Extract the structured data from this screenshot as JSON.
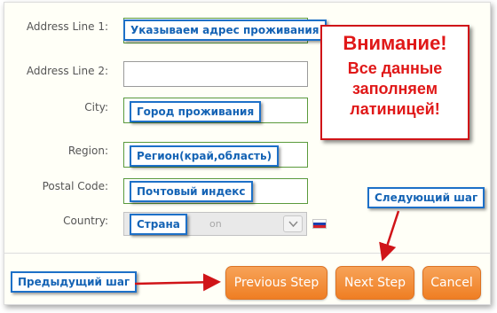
{
  "form": {
    "address1": {
      "label": "Address Line 1:",
      "hint": "Указываем адрес проживания"
    },
    "address2": {
      "label": "Address Line 2:"
    },
    "city": {
      "label": "City:",
      "hint": "Город проживания"
    },
    "region": {
      "label": "Region:",
      "hint": "Регион(край,область)"
    },
    "postal": {
      "label": "Postal Code:",
      "hint": "Почтовый индекс"
    },
    "country": {
      "label": "Country:",
      "hint": "Страна",
      "value_fragment": "on"
    }
  },
  "warning": {
    "title": "Внимание!",
    "body": "Все данные заполняем латиницей!"
  },
  "annotations": {
    "next_step": "Следующий шаг",
    "prev_step": "Предыдущий шаг"
  },
  "buttons": {
    "previous": "Previous Step",
    "next": "Next Step",
    "cancel": "Cancel"
  },
  "colors": {
    "accent_orange": "#ef7e23",
    "hint_blue": "#1d70c8",
    "warning_red": "#e01818",
    "field_border": "#5a9a3c"
  },
  "icons": {
    "country_flag": "russia-flag-icon",
    "select_arrow": "chevron-down-icon"
  }
}
